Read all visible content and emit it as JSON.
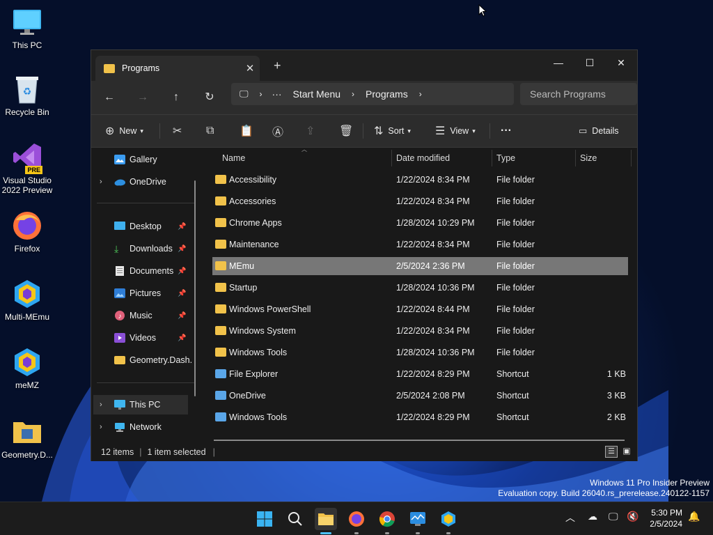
{
  "desktop": {
    "icons": [
      {
        "label": "This PC",
        "icon": "monitor-icon"
      },
      {
        "label": "Recycle Bin",
        "icon": "recycle-bin-icon"
      },
      {
        "label": "Visual Studio 2022 Preview",
        "icon": "visual-studio-icon",
        "badge": "PRE"
      },
      {
        "label": "Firefox",
        "icon": "firefox-icon"
      },
      {
        "label": "Multi-MEmu",
        "icon": "multi-memu-icon"
      },
      {
        "label": "meMZ",
        "icon": "memz-icon"
      },
      {
        "label": "Geometry.D...",
        "icon": "folder-icon"
      }
    ],
    "watermark": {
      "line1": "Windows 11 Pro Insider Preview",
      "line2": "Evaluation copy. Build 26040.rs_prerelease.240122-1157"
    }
  },
  "explorer": {
    "tab_title": "Programs",
    "new_tab": "+",
    "window_controls": {
      "minimize": "—",
      "maximize": "☐",
      "close": "✕"
    },
    "breadcrumb": {
      "ellipsis": "···",
      "items": [
        "Start Menu",
        "Programs"
      ]
    },
    "search_placeholder": "Search Programs",
    "toolbar": {
      "new_label": "New",
      "sort_label": "Sort",
      "view_label": "View",
      "more_label": "···",
      "details_label": "Details"
    },
    "nav": {
      "gallery": "Gallery",
      "onedrive": "OneDrive",
      "quick_access": [
        {
          "label": "Desktop",
          "icon": "desktop-icon",
          "pinned": true
        },
        {
          "label": "Downloads",
          "icon": "download-icon",
          "pinned": true
        },
        {
          "label": "Documents",
          "icon": "documents-icon",
          "pinned": true
        },
        {
          "label": "Pictures",
          "icon": "pictures-icon",
          "pinned": true
        },
        {
          "label": "Music",
          "icon": "music-icon",
          "pinned": true
        },
        {
          "label": "Videos",
          "icon": "videos-icon",
          "pinned": true
        },
        {
          "label": "Geometry.Dash.",
          "icon": "folder-icon",
          "pinned": false
        }
      ],
      "this_pc": "This PC",
      "network": "Network"
    },
    "columns": {
      "name": "Name",
      "date": "Date modified",
      "type": "Type",
      "size": "Size"
    },
    "files": [
      {
        "name": "Accessibility",
        "date": "1/22/2024 8:34 PM",
        "type": "File folder",
        "size": ""
      },
      {
        "name": "Accessories",
        "date": "1/22/2024 8:34 PM",
        "type": "File folder",
        "size": ""
      },
      {
        "name": "Chrome Apps",
        "date": "1/28/2024 10:29 PM",
        "type": "File folder",
        "size": ""
      },
      {
        "name": "Maintenance",
        "date": "1/22/2024 8:34 PM",
        "type": "File folder",
        "size": ""
      },
      {
        "name": "MEmu",
        "date": "2/5/2024 2:36 PM",
        "type": "File folder",
        "size": "",
        "selected": true
      },
      {
        "name": "Startup",
        "date": "1/28/2024 10:36 PM",
        "type": "File folder",
        "size": ""
      },
      {
        "name": "Windows PowerShell",
        "date": "1/22/2024 8:44 PM",
        "type": "File folder",
        "size": ""
      },
      {
        "name": "Windows System",
        "date": "1/22/2024 8:34 PM",
        "type": "File folder",
        "size": ""
      },
      {
        "name": "Windows Tools",
        "date": "1/28/2024 10:36 PM",
        "type": "File folder",
        "size": ""
      },
      {
        "name": "File Explorer",
        "date": "1/22/2024 8:29 PM",
        "type": "Shortcut",
        "size": "1 KB"
      },
      {
        "name": "OneDrive",
        "date": "2/5/2024 2:08 PM",
        "type": "Shortcut",
        "size": "3 KB"
      },
      {
        "name": "Windows Tools",
        "date": "1/22/2024 8:29 PM",
        "type": "Shortcut",
        "size": "2 KB"
      }
    ],
    "status": {
      "count": "12 items",
      "selected": "1 item selected"
    }
  },
  "taskbar": {
    "time": "5:30 PM",
    "date": "2/5/2024"
  }
}
